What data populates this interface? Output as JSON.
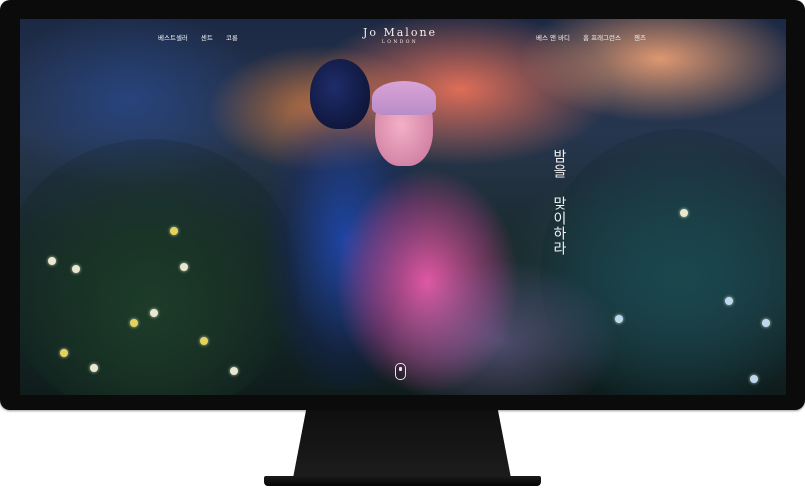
{
  "nav": {
    "left": [
      "베스트셀러",
      "센트",
      "코롱"
    ],
    "right": [
      "베스 앤 바디",
      "홈 프래그런스",
      "젠즈"
    ]
  },
  "logo": {
    "main": "Jo Malone",
    "sub": "LONDON"
  },
  "hero": {
    "headline": "밤을 맞이하라"
  },
  "icons": {
    "scroll": "mouse-scroll-icon"
  }
}
